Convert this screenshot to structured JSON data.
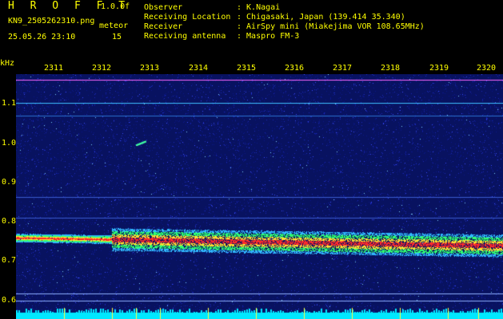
{
  "header": {
    "brand": "H R O F F T",
    "version": "1.0.0f",
    "filename": "KN9_2505262310.png",
    "datetime": "25.05.26 23:10",
    "meteor_label": "meteor",
    "meteor_count": "15"
  },
  "meta": [
    {
      "key": "Observer",
      "value": ": K.Nagai"
    },
    {
      "key": "Receiving Location",
      "value": ": Chigasaki, Japan (139.414 35.340)"
    },
    {
      "key": "Receiver",
      "value": ": AirSpy mini (Miakejima VOR 108.65MHz)"
    },
    {
      "key": "Receiving antenna",
      "value": ": Maspro FM-3"
    }
  ],
  "axis": {
    "y_unit": "kHz",
    "x_ticks": [
      "2311",
      "2312",
      "2313",
      "2314",
      "2315",
      "2316",
      "2317",
      "2318",
      "2319",
      "2320"
    ],
    "y_ticks": [
      "1.1",
      "1.0",
      "0.9",
      "0.8",
      "0.7",
      "0.6"
    ]
  },
  "colors": {
    "text": "#ffff00",
    "background": "#000000",
    "noise_low": "#0a1a80",
    "noise_high": "#3a4cff",
    "signal": "#ff3030",
    "marker": "#ff00ff"
  }
}
